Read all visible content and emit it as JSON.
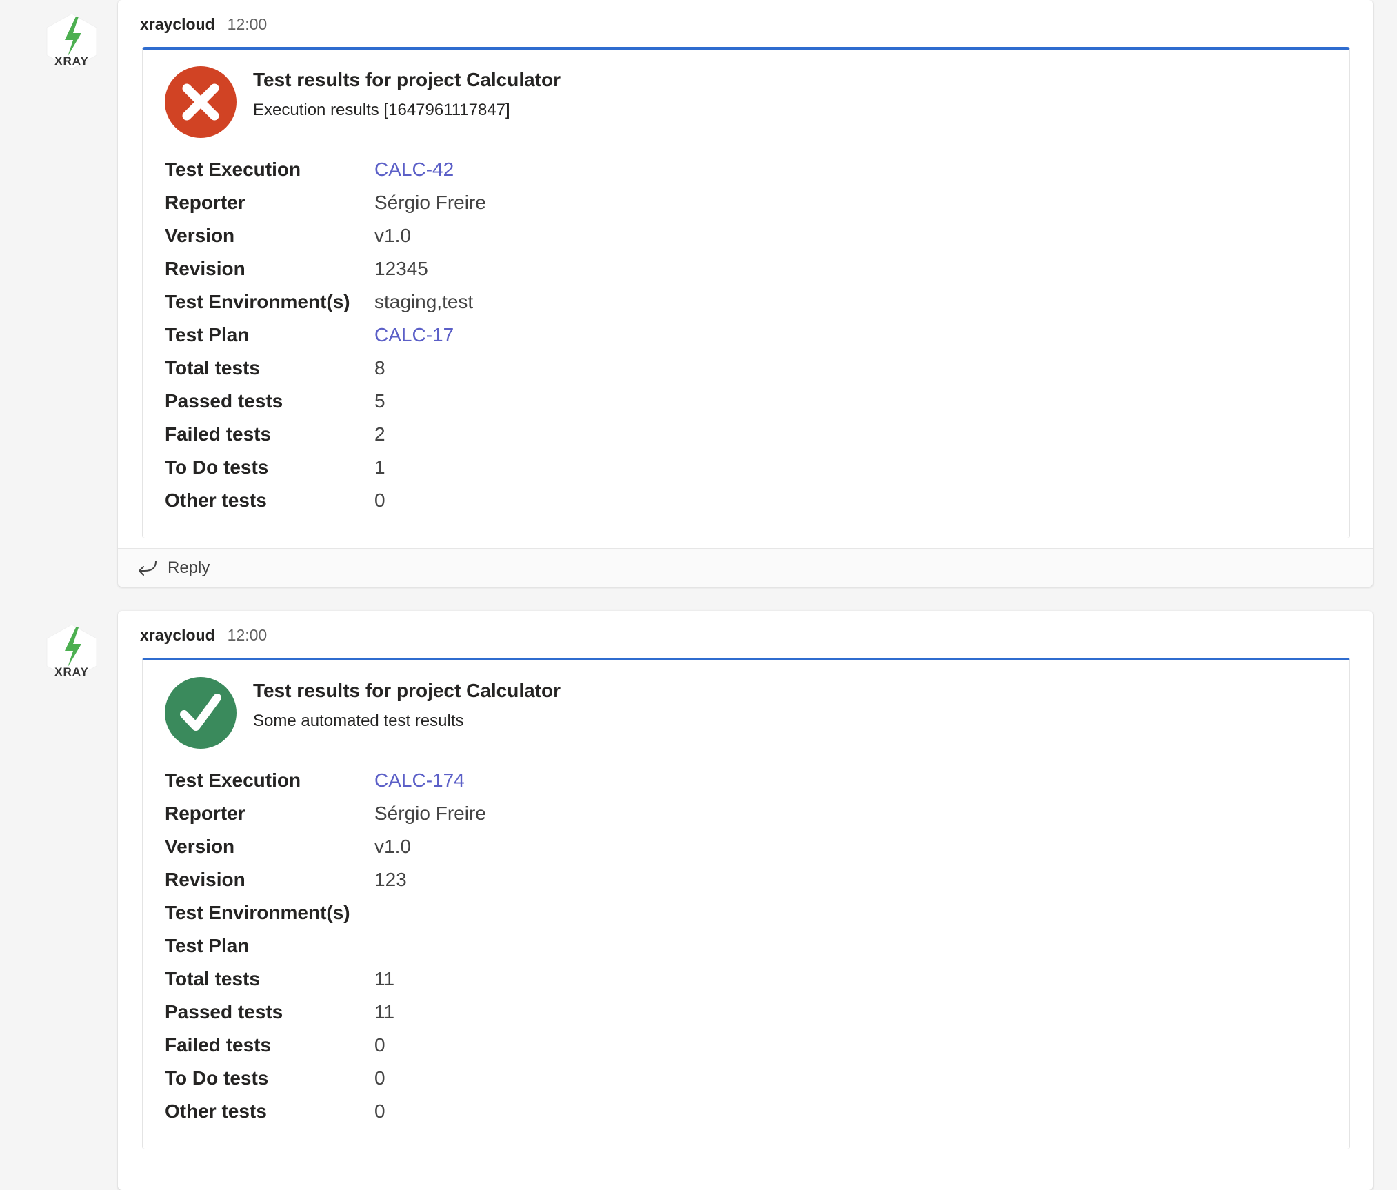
{
  "accent_color": "#2f6ccf",
  "link_color": "#5b5fc7",
  "messages": [
    {
      "avatar_label": "XRAY",
      "avatar_icon": "xray-bolt-icon",
      "sender": "xraycloud",
      "time": "12:00",
      "status": "failed",
      "status_icon": "error-x-icon",
      "status_color": "#d14324",
      "card_title": "Test results for project Calculator",
      "card_subtitle": "Execution results [1647961117847]",
      "facts": [
        {
          "label": "Test Execution",
          "value": "CALC-42",
          "link": true
        },
        {
          "label": "Reporter",
          "value": "Sérgio Freire",
          "link": false
        },
        {
          "label": "Version",
          "value": "v1.0",
          "link": false
        },
        {
          "label": "Revision",
          "value": "12345",
          "link": false
        },
        {
          "label": "Test Environment(s)",
          "value": "staging,test",
          "link": false
        },
        {
          "label": "Test Plan",
          "value": "CALC-17",
          "link": true
        },
        {
          "label": "Total tests",
          "value": "8",
          "link": false
        },
        {
          "label": "Passed tests",
          "value": "5",
          "link": false
        },
        {
          "label": "Failed tests",
          "value": "2",
          "link": false
        },
        {
          "label": "To Do tests",
          "value": "1",
          "link": false
        },
        {
          "label": "Other tests",
          "value": "0",
          "link": false
        }
      ],
      "reply_label": "Reply"
    },
    {
      "avatar_label": "XRAY",
      "avatar_icon": "xray-bolt-icon",
      "sender": "xraycloud",
      "time": "12:00",
      "status": "passed",
      "status_icon": "success-check-icon",
      "status_color": "#3a8a5c",
      "card_title": "Test results for project Calculator",
      "card_subtitle": "Some automated test results",
      "facts": [
        {
          "label": "Test Execution",
          "value": "CALC-174",
          "link": true
        },
        {
          "label": "Reporter",
          "value": "Sérgio Freire",
          "link": false
        },
        {
          "label": "Version",
          "value": "v1.0",
          "link": false
        },
        {
          "label": "Revision",
          "value": "123",
          "link": false
        },
        {
          "label": "Test Environment(s)",
          "value": "",
          "link": false
        },
        {
          "label": "Test Plan",
          "value": "",
          "link": false
        },
        {
          "label": "Total tests",
          "value": "11",
          "link": false
        },
        {
          "label": "Passed tests",
          "value": "11",
          "link": false
        },
        {
          "label": "Failed tests",
          "value": "0",
          "link": false
        },
        {
          "label": "To Do tests",
          "value": "0",
          "link": false
        },
        {
          "label": "Other tests",
          "value": "0",
          "link": false
        }
      ]
    }
  ]
}
